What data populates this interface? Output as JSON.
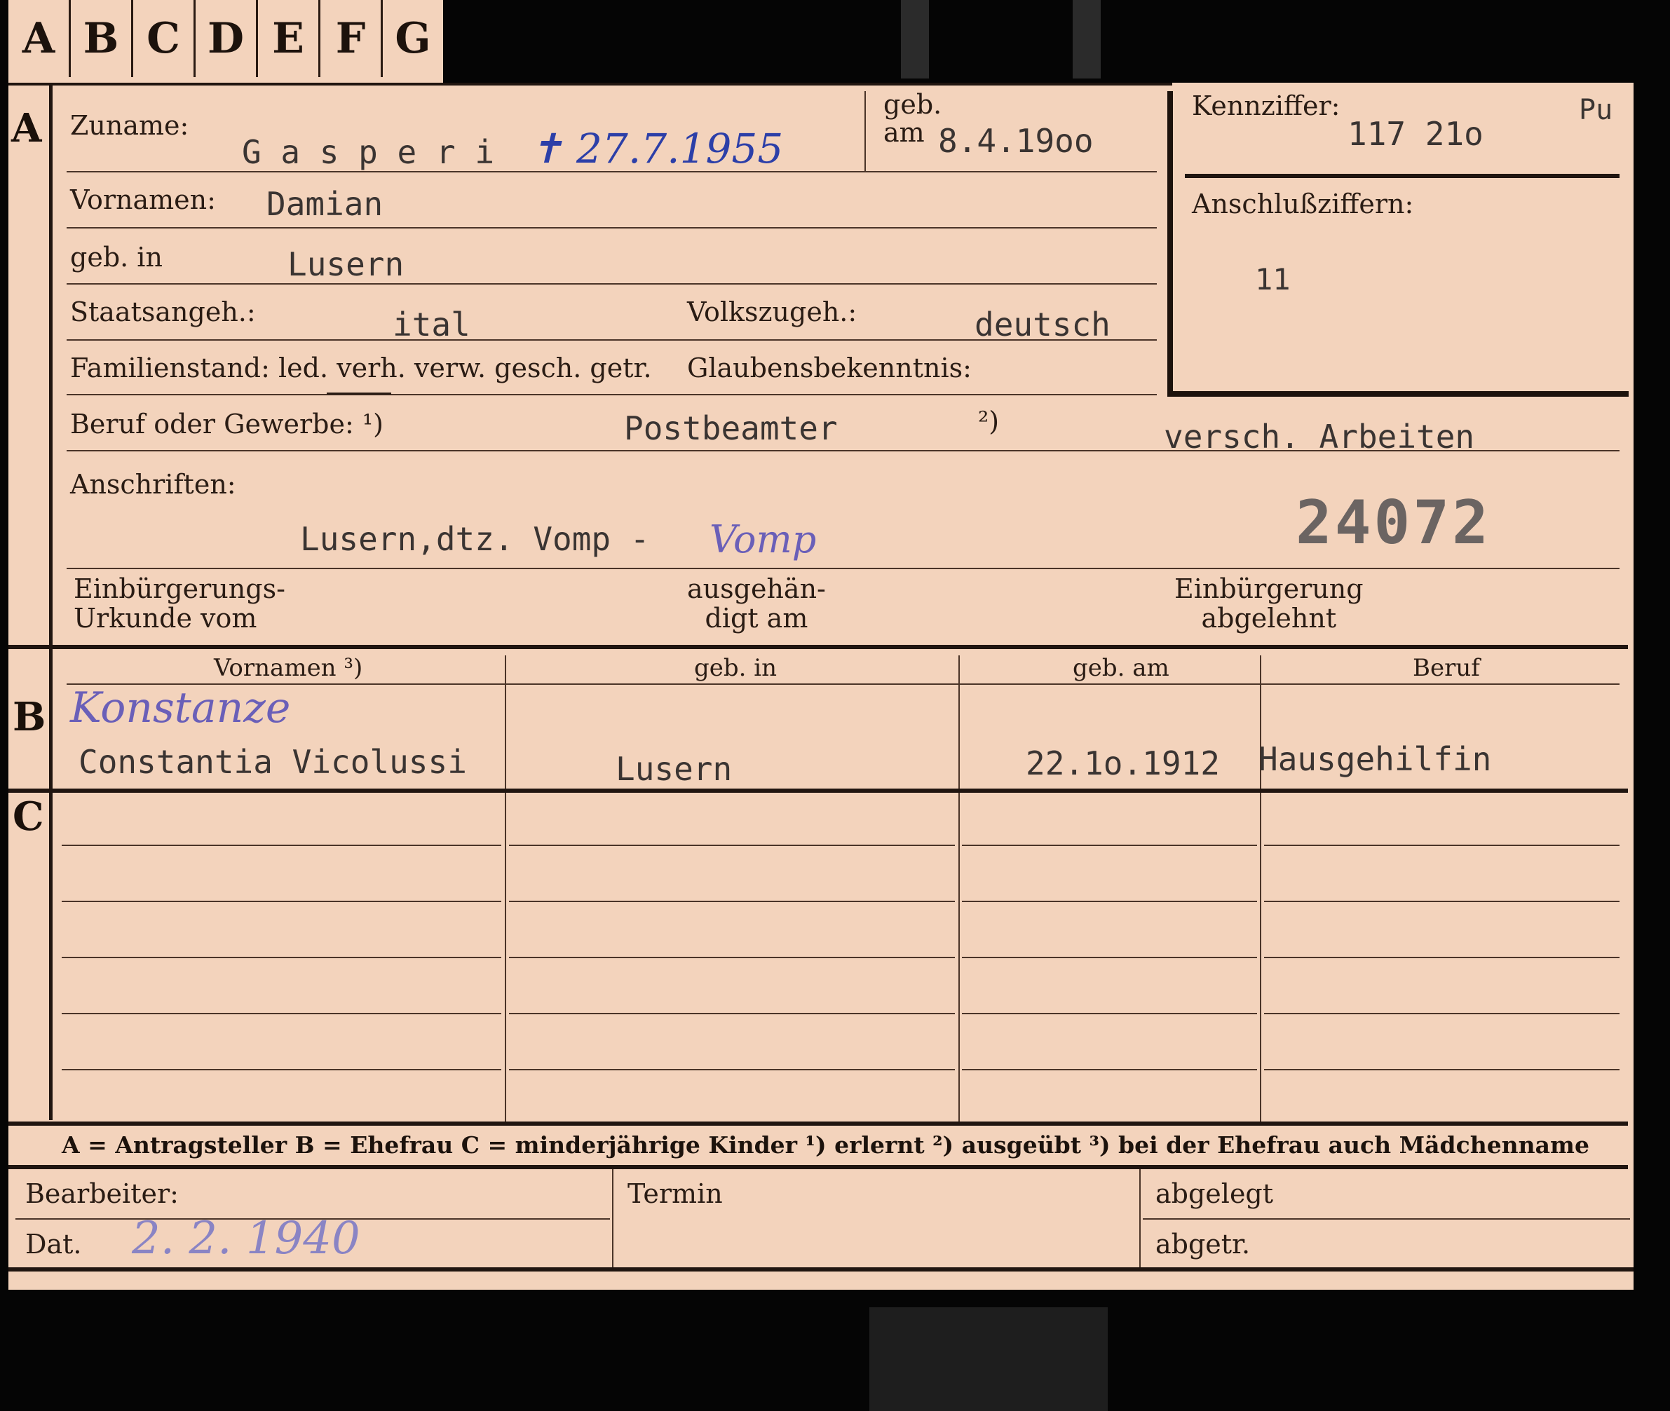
{
  "tabs": [
    "A",
    "B",
    "C",
    "D",
    "E",
    "F",
    "G"
  ],
  "section_markers": {
    "a": "A",
    "b": "B",
    "c": "C"
  },
  "labels": {
    "zuname": "Zuname:",
    "geb_am": "geb.\nam",
    "vornamen": "Vornamen:",
    "geb_in": "geb. in",
    "staatsangeh": "Staatsangeh.:",
    "volkszugeh": "Volkszugeh.:",
    "familienstand": "Familienstand: led. verh. verw. gesch. getr.",
    "glaubensbekenntnis": "Glaubensbekenntnis:",
    "beruf": "Beruf oder Gewerbe: ¹)",
    "beruf_2": "²)",
    "anschriften": "Anschriften:",
    "einbuergerungs_urkunde": "Einbürgerungs-\nUrkunde vom",
    "ausgehaendigt": "ausgehän-\ndigt am",
    "einbuergerung_abgelehnt": "Einbürgerung\nabgelehnt",
    "kennziffer": "Kennziffer:",
    "anschlussziffern": "Anschlußziffern:"
  },
  "values": {
    "zuname": "G a s p e r i",
    "death_note": "✝ 27.7.1955",
    "geb_am": "8.4.19oo",
    "vornamen": "Damian",
    "geb_in": "Lusern",
    "staatsangeh": "ital",
    "volkszugeh": "deutsch",
    "beruf_erlernt": "Postbeamter",
    "beruf_ausgeuebt": "versch. Arbeiten",
    "anschrift": "Lusern,dtz. Vomp -",
    "anschrift_hand": "Vomp",
    "stamp_number": "24072",
    "kennziffer": "117 21o",
    "kennziffer_suffix": "Pu",
    "anschlussziffern": "11"
  },
  "spouse_table": {
    "headers": [
      "Vornamen ³)",
      "geb. in",
      "geb. am",
      "Beruf"
    ],
    "hand_name": "Konstanze",
    "row": [
      "Constantia Vicolussi",
      "Lusern",
      "22.1o.1912",
      "Hausgehilfin"
    ]
  },
  "legend": "A = Antragsteller   B = Ehefrau   C = minderjährige Kinder   ¹) erlernt   ²) ausgeübt   ³) bei der Ehefrau auch Mädchenname",
  "footer": {
    "bearbeiter": "Bearbeiter:",
    "dat": "Dat.",
    "dat_value": "2. 2. 1940",
    "termin": "Termin",
    "abgelegt": "abgelegt",
    "abgetr": "abgetr."
  },
  "colors": {
    "card": "#f3d3bc",
    "ink_blue": "#2c3fa8",
    "ink_violet": "#6a5fb8",
    "typewriter": "#3a3432"
  }
}
